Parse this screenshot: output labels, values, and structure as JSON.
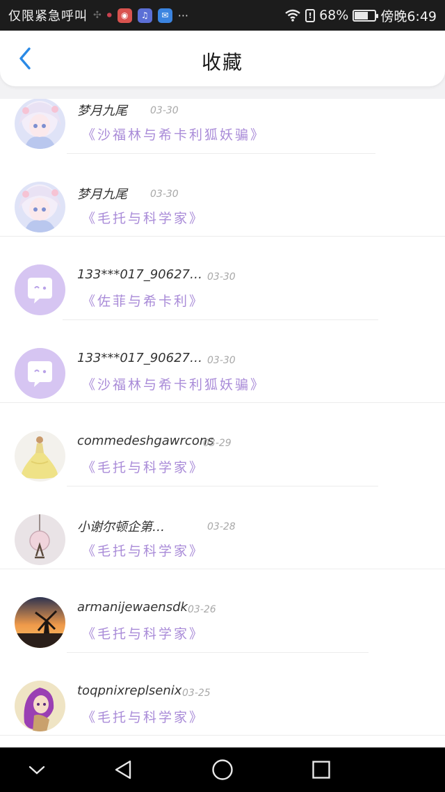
{
  "status_bar": {
    "carrier": "仅限紧急呼叫",
    "battery": "68%",
    "battery_level": 0.68,
    "time": "傍晚6:49",
    "dots": "···"
  },
  "header": {
    "title": "收藏"
  },
  "favorites": [
    {
      "user": "梦月九尾",
      "date": "03-30",
      "book": "《沙福林与希卡利狐妖骗》",
      "avatar": "anime-girl-avatar"
    },
    {
      "user": "梦月九尾",
      "date": "03-30",
      "book": "《毛托与科学家》",
      "avatar": "anime-girl-avatar"
    },
    {
      "user": "133***017_90627…",
      "date": "03-30",
      "book": "《佐菲与希卡利》",
      "avatar": "chat-bubble-avatar"
    },
    {
      "user": "133***017_90627…",
      "date": "03-30",
      "book": "《沙福林与希卡利狐妖骗》",
      "avatar": "chat-bubble-avatar"
    },
    {
      "user": "commedeshgawrcons",
      "date": "03-29",
      "book": "《毛托与科学家》",
      "avatar": "princess-dress-avatar"
    },
    {
      "user": "小谢尔顿企第…",
      "date": "03-28",
      "book": "《毛托与科学家》",
      "avatar": "pendant-avatar"
    },
    {
      "user": "armanijewaensdk",
      "date": "03-26",
      "book": "《毛托与科学家》",
      "avatar": "windmill-sunset-avatar"
    },
    {
      "user": "toqpnixreplsenix",
      "date": "03-25",
      "book": "《毛托与科学家》",
      "avatar": "purple-hair-girl-avatar"
    }
  ],
  "colors": {
    "accent_blue": "#2a8ae6",
    "book_purple": "#a98bd8",
    "avatar_purple": "#d6c5f2"
  }
}
